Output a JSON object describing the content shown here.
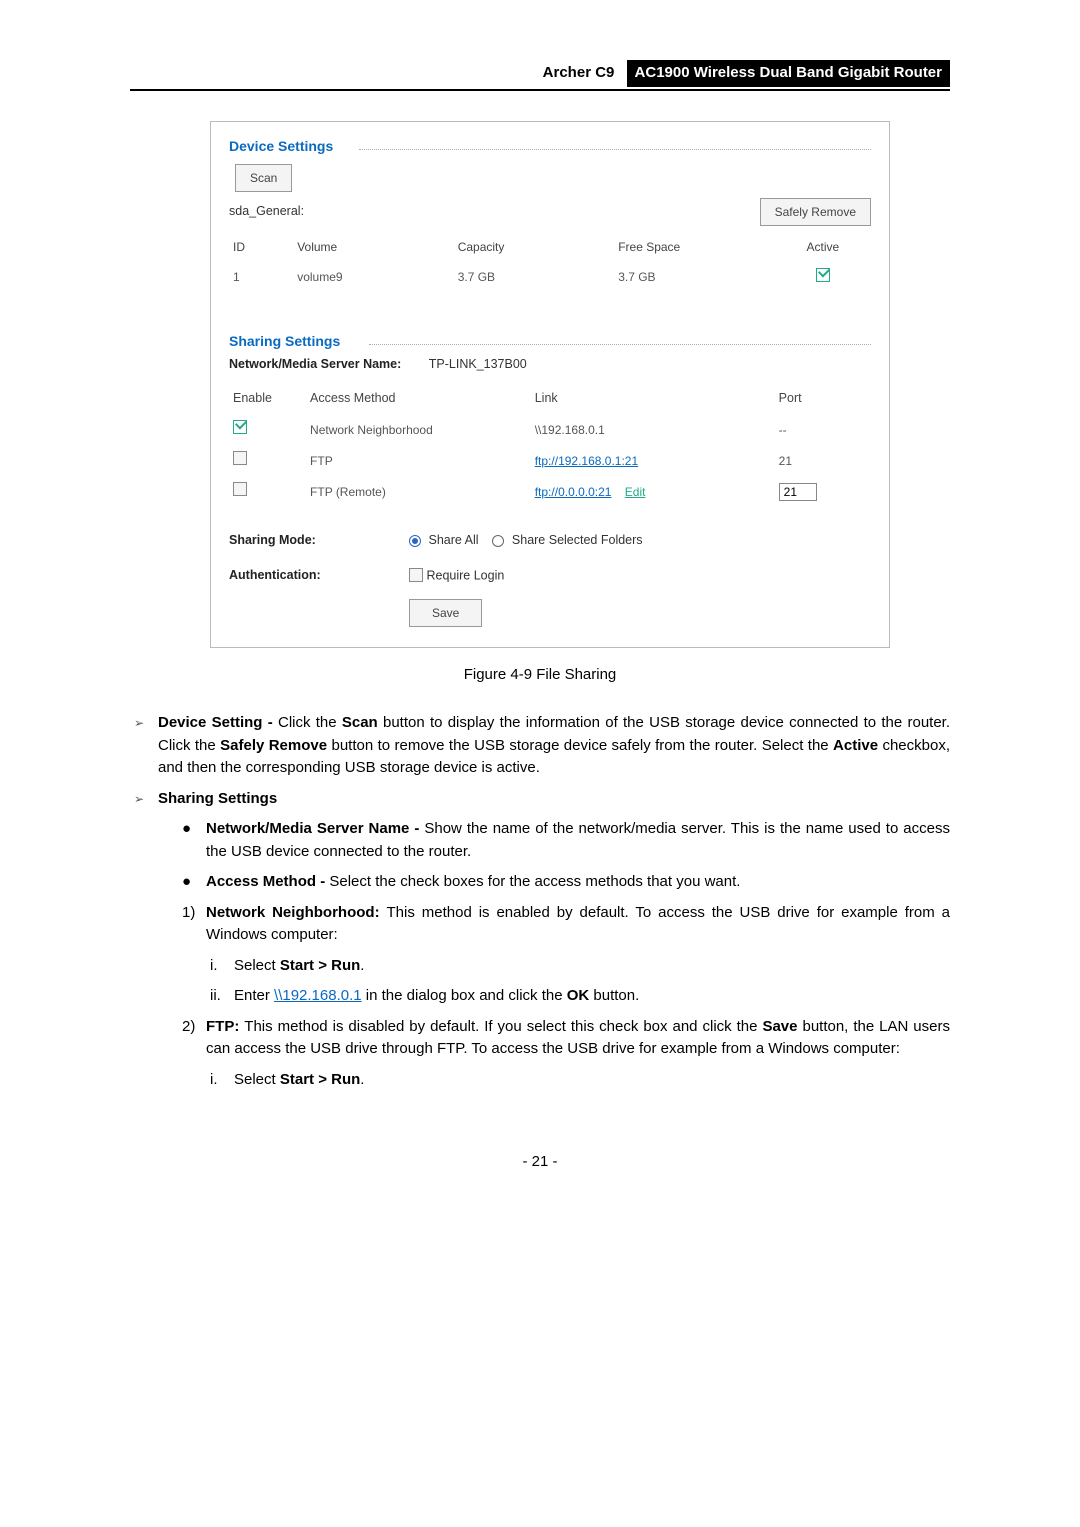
{
  "header": {
    "model": "Archer C9",
    "product": "AC1900 Wireless Dual Band Gigabit Router"
  },
  "panel": {
    "devset_title": "Device Settings",
    "scan_btn": "Scan",
    "disk_label": "sda_General:",
    "safely_remove_btn": "Safely Remove",
    "cols": {
      "id": "ID",
      "vol": "Volume",
      "cap": "Capacity",
      "free": "Free Space",
      "active": "Active"
    },
    "row": {
      "id": "1",
      "vol": "volume9",
      "cap": "3.7 GB",
      "free": "3.7 GB"
    },
    "sharing_title": "Sharing Settings",
    "nmsn_label": "Network/Media Server Name:",
    "nmsn_value": "TP-LINK_137B00",
    "scols": {
      "enable": "Enable",
      "method": "Access Method",
      "link": "Link",
      "port": "Port"
    },
    "srows": {
      "nn": {
        "method": "Network Neighborhood",
        "link": "\\\\192.168.0.1",
        "port": "--"
      },
      "ftp": {
        "method": "FTP",
        "link": "ftp://192.168.0.1:21",
        "port": "21"
      },
      "ftpr": {
        "method": "FTP (Remote)",
        "link": "ftp://0.0.0.0:21",
        "edit": "Edit",
        "port": "21"
      }
    },
    "sharing_mode_label": "Sharing Mode:",
    "share_all": "Share All",
    "share_sel": "Share Selected Folders",
    "auth_label": "Authentication:",
    "req_login": "Require Login",
    "save_btn": "Save"
  },
  "caption": "Figure 4-9 File Sharing",
  "b1": {
    "lead": "Device Setting - ",
    "t1": "Click the ",
    "scan": "Scan",
    "t2": " button to display the information of the USB storage device connected to the router. Click the ",
    "sr": "Safely Remove",
    "t3": " button to remove the USB storage device safely from the router. Select the ",
    "active": "Active",
    "t4": " checkbox, and then the corresponding USB storage device is active."
  },
  "b2": {
    "title": "Sharing Settings"
  },
  "b2a": {
    "lead": "Network/Media Server Name - ",
    "text": "Show the name of the network/media server. This is the name used to access the USB device connected to the router."
  },
  "b2b": {
    "lead": "Access Method - ",
    "text": "Select the check boxes for the access methods that you want."
  },
  "b2n1": {
    "num": "1)",
    "lead": "Network Neighborhood: ",
    "text": "This method is enabled by default. To access the USB drive for example from a Windows computer:"
  },
  "b2n1i": {
    "num": "i.",
    "t1": "Select ",
    "bold": "Start > Run",
    "t2": "."
  },
  "b2n1ii": {
    "num": "ii.",
    "t1": "Enter ",
    "link": "\\\\192.168.0.1",
    "t2": " in the dialog box and click the ",
    "ok": "OK",
    "t3": " button."
  },
  "b2n2": {
    "num": "2)",
    "lead": "FTP: ",
    "t1": "This method is disabled by default. If you select this check box and click the ",
    "save": "Save",
    "t2": " button, the LAN users can access the USB drive through FTP. To access the USB drive for example from a Windows computer:"
  },
  "b2n2i": {
    "num": "i.",
    "t1": "Select ",
    "bold": "Start > Run",
    "t2": "."
  },
  "pagenum": "- 21 -"
}
